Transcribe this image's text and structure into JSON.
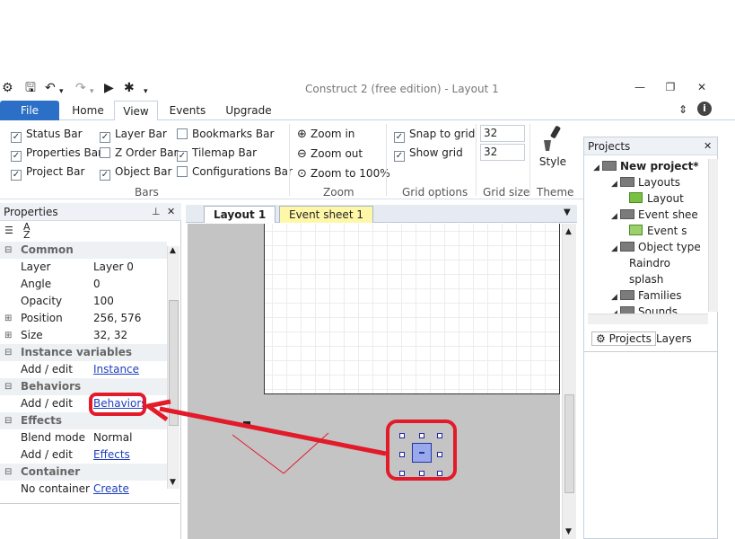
{
  "window": {
    "title": "Construct 2  (free edition) - Layout 1",
    "minimize": "—",
    "restore": "❐",
    "close": "✕"
  },
  "menu_tabs": [
    "File",
    "Home",
    "View",
    "Events",
    "Upgrade"
  ],
  "ribbon": {
    "bars": {
      "items": [
        {
          "label": "Status Bar",
          "checked": true
        },
        {
          "label": "Properties Bar",
          "checked": true
        },
        {
          "label": "Project Bar",
          "checked": true
        },
        {
          "label": "Layer Bar",
          "checked": true
        },
        {
          "label": "Z Order Bar",
          "checked": false
        },
        {
          "label": "Object Bar",
          "checked": true
        },
        {
          "label": "Bookmarks Bar",
          "checked": false
        },
        {
          "label": "Tilemap Bar",
          "checked": true
        },
        {
          "label": "Configurations Bar",
          "checked": false
        }
      ],
      "group_label": "Bars"
    },
    "zoom": {
      "zoom_in": "Zoom in",
      "zoom_out": "Zoom out",
      "zoom_100": "Zoom to 100%",
      "group_label": "Zoom"
    },
    "grid_options": {
      "snap": "Snap to grid",
      "show": "Show grid",
      "group_label": "Grid options"
    },
    "grid_size": {
      "width": "32",
      "height": "32",
      "group_label": "Grid size"
    },
    "theme": {
      "style": "Style",
      "group_label": "Theme"
    }
  },
  "properties": {
    "title": "Properties",
    "rows": [
      {
        "type": "cat",
        "name": "Common"
      },
      {
        "type": "prop",
        "name": "Layer",
        "value": "Layer 0"
      },
      {
        "type": "prop",
        "name": "Angle",
        "value": "0"
      },
      {
        "type": "prop",
        "name": "Opacity",
        "value": "100"
      },
      {
        "type": "prop",
        "name": "Position",
        "value": "256, 576",
        "expand": true
      },
      {
        "type": "prop",
        "name": "Size",
        "value": "32, 32",
        "expand": true
      },
      {
        "type": "cat",
        "name": "Instance variables"
      },
      {
        "type": "prop",
        "name": "Add / edit",
        "value": "Instance vari...",
        "link": true
      },
      {
        "type": "cat",
        "name": "Behaviors"
      },
      {
        "type": "prop",
        "name": "Add / edit",
        "value": "Behaviors",
        "link": true
      },
      {
        "type": "cat",
        "name": "Effects"
      },
      {
        "type": "prop",
        "name": "Blend mode",
        "value": "Normal"
      },
      {
        "type": "prop",
        "name": "Add / edit",
        "value": "Effects",
        "link": true
      },
      {
        "type": "cat",
        "name": "Container"
      },
      {
        "type": "prop",
        "name": "No container",
        "value": "Create",
        "link": true
      }
    ]
  },
  "doc_tabs": [
    "Layout 1",
    "Event sheet 1"
  ],
  "projects": {
    "title": "Projects",
    "tree": [
      {
        "label": "New project*",
        "level": 0,
        "icon": "folder",
        "bold": true
      },
      {
        "label": "Layouts",
        "level": 1,
        "icon": "folder"
      },
      {
        "label": "Layout",
        "level": 2,
        "icon": "layout"
      },
      {
        "label": "Event shee",
        "level": 1,
        "icon": "folder"
      },
      {
        "label": "Event s",
        "level": 2,
        "icon": "sheet"
      },
      {
        "label": "Object type",
        "level": 1,
        "icon": "folder"
      },
      {
        "label": "Raindro",
        "level": 2,
        "icon": "none"
      },
      {
        "label": "splash",
        "level": 2,
        "icon": "none"
      },
      {
        "label": "Families",
        "level": 1,
        "icon": "folder"
      },
      {
        "label": "Sounds",
        "level": 1,
        "icon": "folder"
      }
    ],
    "tabs": [
      "Projects",
      "Layers"
    ]
  },
  "colors": {
    "accent": "#2b6fc7",
    "annotation": "#e21a2a",
    "link": "#1f3fbf",
    "event_tab": "#fff7a8"
  }
}
